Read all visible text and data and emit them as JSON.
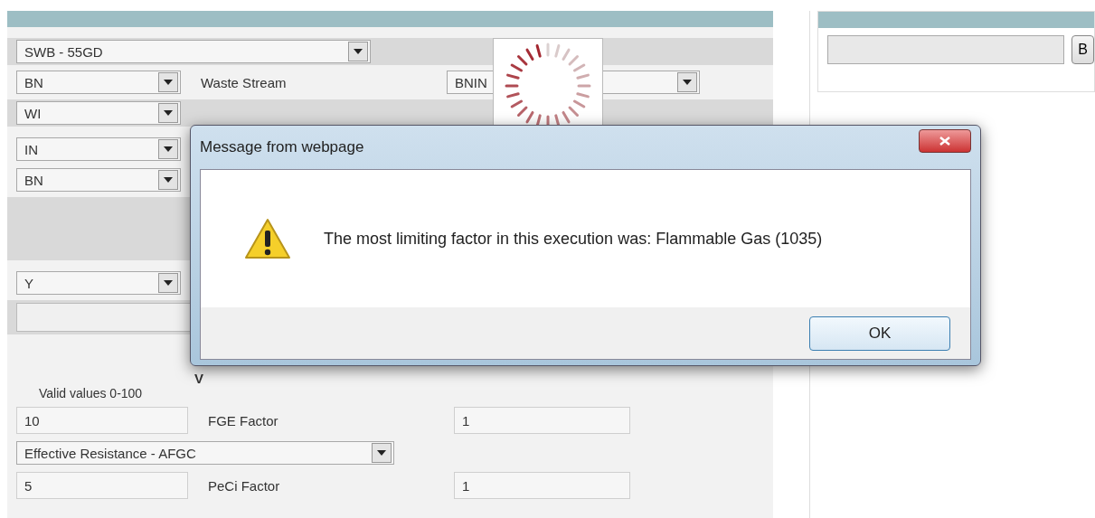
{
  "main_select": "SWB - 55GD",
  "selects": [
    {
      "value": "BN",
      "label": "Waste Stream",
      "value2": "BNIN"
    },
    {
      "value": "WI"
    },
    {
      "value": "IN"
    },
    {
      "value": "BN"
    }
  ],
  "flag_select": "Y",
  "section_title": "V",
  "hint": "Valid values 0-100",
  "factor_rows": [
    {
      "kind": "factor",
      "value": "10",
      "label": "FGE Factor",
      "factor": "1"
    },
    {
      "kind": "select",
      "value": "Effective Resistance - AFGC"
    },
    {
      "kind": "factor",
      "value": "5",
      "label": "PeCi Factor",
      "factor": "1"
    }
  ],
  "upload": {
    "button": "B"
  },
  "dialog": {
    "title": "Message from webpage",
    "message": "The most limiting factor in this execution was: Flammable Gas (1035)",
    "button": "OK"
  }
}
